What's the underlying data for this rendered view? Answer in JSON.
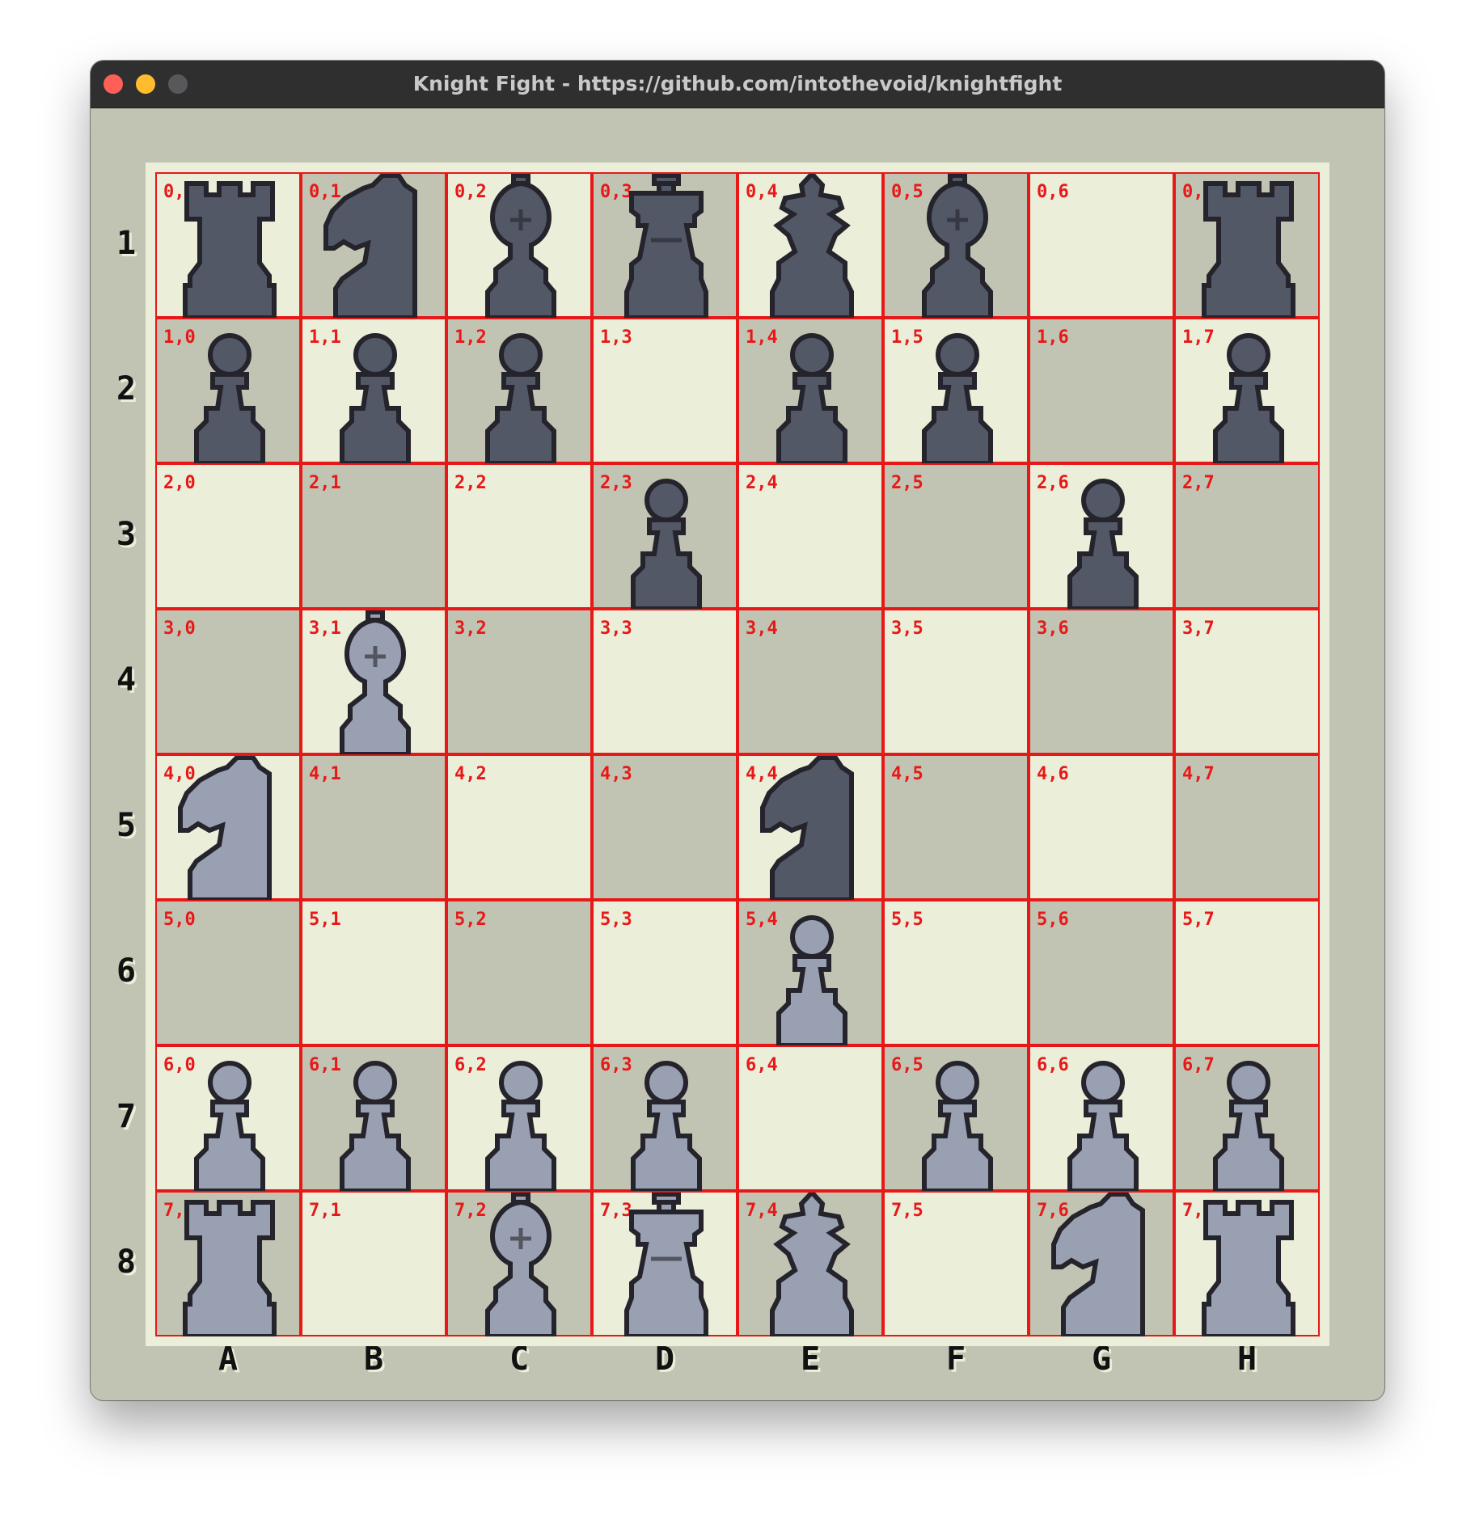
{
  "window": {
    "title": "Knight Fight - https://github.com/intothevoid/knightfight"
  },
  "colors": {
    "light_square": "#ebeed9",
    "dark_square": "#c1c4b2",
    "grid_line": "#e81818",
    "dark_piece": "#525866",
    "light_piece": "#98a0b2"
  },
  "ranks": [
    "1",
    "2",
    "3",
    "4",
    "5",
    "6",
    "7",
    "8"
  ],
  "files": [
    "A",
    "B",
    "C",
    "D",
    "E",
    "F",
    "G",
    "H"
  ],
  "coords": [
    [
      "0,0",
      "0,1",
      "0,2",
      "0,3",
      "0,4",
      "0,5",
      "0,6",
      "0,7"
    ],
    [
      "1,0",
      "1,1",
      "1,2",
      "1,3",
      "1,4",
      "1,5",
      "1,6",
      "1,7"
    ],
    [
      "2,0",
      "2,1",
      "2,2",
      "2,3",
      "2,4",
      "2,5",
      "2,6",
      "2,7"
    ],
    [
      "3,0",
      "3,1",
      "3,2",
      "3,3",
      "3,4",
      "3,5",
      "3,6",
      "3,7"
    ],
    [
      "4,0",
      "4,1",
      "4,2",
      "4,3",
      "4,4",
      "4,5",
      "4,6",
      "4,7"
    ],
    [
      "5,0",
      "5,1",
      "5,2",
      "5,3",
      "5,4",
      "5,5",
      "5,6",
      "5,7"
    ],
    [
      "6,0",
      "6,1",
      "6,2",
      "6,3",
      "6,4",
      "6,5",
      "6,6",
      "6,7"
    ],
    [
      "7,0",
      "7,1",
      "7,2",
      "7,3",
      "7,4",
      "7,5",
      "7,6",
      "7,7"
    ]
  ],
  "board": [
    [
      "dark-rook",
      "dark-knight",
      "dark-bishop",
      "dark-queen",
      "dark-king",
      "dark-bishop",
      "",
      "dark-rook"
    ],
    [
      "dark-pawn",
      "dark-pawn",
      "dark-pawn",
      "",
      "dark-pawn",
      "dark-pawn",
      "",
      "dark-pawn"
    ],
    [
      "",
      "",
      "",
      "dark-pawn",
      "",
      "",
      "dark-pawn",
      ""
    ],
    [
      "",
      "light-bishop",
      "",
      "",
      "",
      "",
      "",
      ""
    ],
    [
      "light-knight",
      "",
      "",
      "",
      "dark-knight",
      "",
      "",
      ""
    ],
    [
      "",
      "",
      "",
      "",
      "light-pawn",
      "",
      "",
      ""
    ],
    [
      "light-pawn",
      "light-pawn",
      "light-pawn",
      "light-pawn",
      "",
      "light-pawn",
      "light-pawn",
      "light-pawn"
    ],
    [
      "light-rook",
      "",
      "light-bishop",
      "light-queen",
      "light-king",
      "",
      "light-knight",
      "light-rook"
    ]
  ]
}
